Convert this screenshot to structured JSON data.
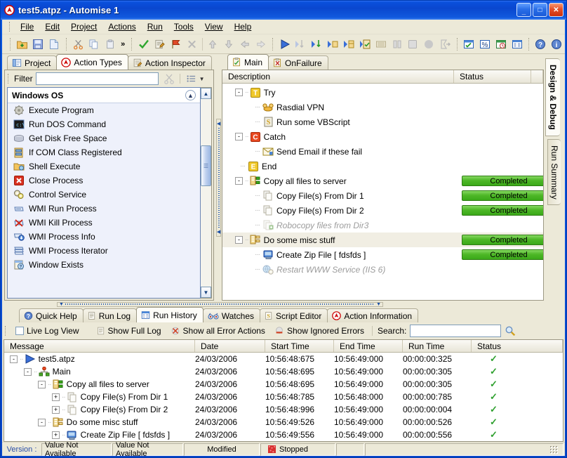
{
  "window": {
    "title": "test5.atpz - Automise 1",
    "app_icon": "automise-logo-icon",
    "minimize": "_",
    "maximize": "□",
    "close": "✕"
  },
  "menu": [
    {
      "label": "File"
    },
    {
      "label": "Edit"
    },
    {
      "label": "Project"
    },
    {
      "label": "Actions"
    },
    {
      "label": "Run"
    },
    {
      "label": "Tools"
    },
    {
      "label": "View"
    },
    {
      "label": "Help"
    }
  ],
  "toolbar": {
    "overflow_label": "»",
    "groups": [
      [
        "open-project-icon",
        "save-icon",
        "new-file-icon"
      ],
      [
        "cut-icon",
        "copy-icon",
        "paste-icon"
      ],
      [
        "check-icon",
        "edit-action-icon",
        "breakpoint-icon",
        "delete-icon",
        "move-up-icon",
        "move-down-icon",
        "move-left-icon",
        "move-right-icon"
      ],
      [
        "run-icon",
        "run-to-cursor-icon",
        "step-into-icon",
        "step-over-icon",
        "step-out-icon",
        "run-selected-icon",
        "pause-icon",
        "pause2-icon",
        "stop-icon",
        "abort-icon",
        "timeout-icon"
      ],
      [
        "options-icon",
        "variables-icon",
        "scheduler-icon",
        "log-icon"
      ],
      [
        "help-icon",
        "about-icon"
      ]
    ]
  },
  "left_panel": {
    "tabs": [
      {
        "label": "Project",
        "icon": "project-icon",
        "active": false
      },
      {
        "label": "Action Types",
        "icon": "automise-logo-icon",
        "active": true
      },
      {
        "label": "Action Inspector",
        "icon": "inspector-icon",
        "active": false
      }
    ],
    "filter": {
      "label": "Filter",
      "value": "",
      "placeholder": "",
      "clear_icon": "clear-filter-icon",
      "view_icon": "list-view-icon",
      "dropdown_icon": "chevron-down-icon"
    },
    "group": {
      "title": "Windows OS",
      "collapse_icon": "chevron-up-icon"
    },
    "actions": [
      {
        "label": "Execute Program",
        "icon": "gear-icon"
      },
      {
        "label": "Run DOS Command",
        "icon": "console-icon"
      },
      {
        "label": "Get Disk Free Space",
        "icon": "disk-icon"
      },
      {
        "label": "If COM Class Registered",
        "icon": "com-class-icon"
      },
      {
        "label": "Shell Execute",
        "icon": "shell-folder-icon"
      },
      {
        "label": "Close Process",
        "icon": "red-x-icon"
      },
      {
        "label": "Control Service",
        "icon": "service-gears-icon"
      },
      {
        "label": "WMI Run Process",
        "icon": "wmi-run-icon"
      },
      {
        "label": "WMI Kill Process",
        "icon": "wmi-kill-icon"
      },
      {
        "label": "WMI Process Info",
        "icon": "wmi-info-icon"
      },
      {
        "label": "WMI Process Iterator",
        "icon": "wmi-iterator-icon"
      },
      {
        "label": "Window Exists",
        "icon": "window-exists-icon"
      }
    ]
  },
  "main_panel": {
    "tabs": [
      {
        "label": "Main",
        "icon": "script-icon",
        "active": true
      },
      {
        "label": "OnFailure",
        "icon": "script-fail-icon",
        "active": false
      }
    ],
    "columns": [
      "Description",
      "Status"
    ],
    "rows": [
      {
        "indent": 0,
        "expander": "-",
        "icon": "try-icon",
        "label": "Try",
        "status": "",
        "disabled": false,
        "selected": false
      },
      {
        "indent": 1,
        "expander": "",
        "icon": "phone-icon",
        "label": "Rasdial VPN",
        "status": "",
        "disabled": false,
        "selected": false
      },
      {
        "indent": 1,
        "expander": "",
        "icon": "vbscript-icon",
        "label": "Run some VBScript",
        "status": "",
        "disabled": false,
        "selected": false
      },
      {
        "indent": 0,
        "expander": "-",
        "icon": "catch-icon",
        "label": "Catch",
        "status": "",
        "disabled": false,
        "selected": false
      },
      {
        "indent": 1,
        "expander": "",
        "icon": "email-icon",
        "label": "Send Email if these fail",
        "status": "",
        "disabled": false,
        "selected": false
      },
      {
        "indent": 0,
        "expander": "",
        "icon": "end-icon",
        "label": "End",
        "status": "",
        "disabled": false,
        "selected": false
      },
      {
        "indent": 0,
        "expander": "-",
        "icon": "group-run-icon",
        "label": "Copy all files to server",
        "status": "Completed",
        "disabled": false,
        "selected": false
      },
      {
        "indent": 1,
        "expander": "",
        "icon": "copy-file-icon",
        "label": "Copy File(s) From Dir 1",
        "status": "Completed",
        "disabled": false,
        "selected": false
      },
      {
        "indent": 1,
        "expander": "",
        "icon": "copy-file-icon",
        "label": "Copy File(s) From Dir 2",
        "status": "Completed",
        "disabled": false,
        "selected": false
      },
      {
        "indent": 1,
        "expander": "",
        "icon": "robocopy-icon",
        "label": "Robocopy files from Dir3",
        "status": "",
        "disabled": true,
        "selected": false
      },
      {
        "indent": 0,
        "expander": "-",
        "icon": "group-icon",
        "label": "Do some misc stuff",
        "status": "Completed",
        "disabled": false,
        "selected": true
      },
      {
        "indent": 1,
        "expander": "",
        "icon": "zip-icon",
        "label": "Create Zip File [ fdsfds ]",
        "status": "Completed",
        "disabled": false,
        "selected": false
      },
      {
        "indent": 1,
        "expander": "",
        "icon": "iis-icon",
        "label": "Restart WWW Service (IIS 6)",
        "status": "",
        "disabled": true,
        "selected": false
      }
    ]
  },
  "right_tabs": [
    {
      "label": "Design & Debug",
      "active": true
    },
    {
      "label": "Run Summary",
      "active": false
    }
  ],
  "bottom_panel": {
    "tabs": [
      {
        "label": "Quick Help",
        "icon": "help-icon",
        "active": false
      },
      {
        "label": "Run Log",
        "icon": "log-icon",
        "active": false
      },
      {
        "label": "Run History",
        "icon": "history-icon",
        "active": true
      },
      {
        "label": "Watches",
        "icon": "watches-icon",
        "active": false
      },
      {
        "label": "Script Editor",
        "icon": "script-editor-icon",
        "active": false
      },
      {
        "label": "Action Information",
        "icon": "automise-logo-icon",
        "active": false
      }
    ],
    "toolbar": {
      "live_log_view": {
        "label": "Live Log View",
        "checked": false
      },
      "show_full_log": {
        "label": "Show Full Log",
        "icon": "full-log-icon"
      },
      "show_all_error_actions": {
        "label": "Show all Error Actions",
        "icon": "error-actions-icon"
      },
      "show_ignored_errors": {
        "label": "Show Ignored Errors",
        "icon": "ignored-errors-icon"
      },
      "search_label": "Search:",
      "search_value": "",
      "search_placeholder": "",
      "search_icon": "magnifier-icon"
    },
    "columns": [
      "Message",
      "Date",
      "Start Time",
      "End Time",
      "Run Time",
      "Status"
    ],
    "rows": [
      {
        "indent": 0,
        "expander": "-",
        "icon": "project-run-icon",
        "message": "test5.atpz",
        "date": "24/03/2006",
        "start": "10:56:48:675",
        "end": "10:56:49:000",
        "runtime": "00:00:00:325",
        "status": "ok"
      },
      {
        "indent": 1,
        "expander": "-",
        "icon": "main-target-icon",
        "message": "Main",
        "date": "24/03/2006",
        "start": "10:56:48:695",
        "end": "10:56:49:000",
        "runtime": "00:00:00:305",
        "status": "ok"
      },
      {
        "indent": 2,
        "expander": "-",
        "icon": "group-run-icon",
        "message": "Copy all files to server",
        "date": "24/03/2006",
        "start": "10:56:48:695",
        "end": "10:56:49:000",
        "runtime": "00:00:00:305",
        "status": "ok"
      },
      {
        "indent": 3,
        "expander": "+",
        "icon": "copy-file-icon",
        "message": "Copy File(s) From Dir 1",
        "date": "24/03/2006",
        "start": "10:56:48:785",
        "end": "10:56:48:000",
        "runtime": "00:00:00:785",
        "status": "ok"
      },
      {
        "indent": 3,
        "expander": "+",
        "icon": "copy-file-icon",
        "message": "Copy File(s) From Dir 2",
        "date": "24/03/2006",
        "start": "10:56:48:996",
        "end": "10:56:49:000",
        "runtime": "00:00:00:004",
        "status": "ok"
      },
      {
        "indent": 2,
        "expander": "-",
        "icon": "group-icon",
        "message": "Do some misc stuff",
        "date": "24/03/2006",
        "start": "10:56:49:526",
        "end": "10:56:49:000",
        "runtime": "00:00:00:526",
        "status": "ok"
      },
      {
        "indent": 3,
        "expander": "+",
        "icon": "zip-icon",
        "message": "Create Zip File [ fdsfds ]",
        "date": "24/03/2006",
        "start": "10:56:49:556",
        "end": "10:56:49:000",
        "runtime": "00:00:00:556",
        "status": "ok"
      }
    ]
  },
  "statusbar": {
    "version_label": "Version :",
    "version_value": "Value Not Available",
    "second_value": "Value Not Available",
    "modified": "Modified",
    "run_state": "Stopped",
    "run_state_icon": "stopped-icon"
  },
  "colors": {
    "title_blue": "#0a4fd8",
    "face": "#ece9d8",
    "completed_green": "#4fb828",
    "list_bg": "#eef1fb",
    "tick_green": "#2fa02f"
  }
}
